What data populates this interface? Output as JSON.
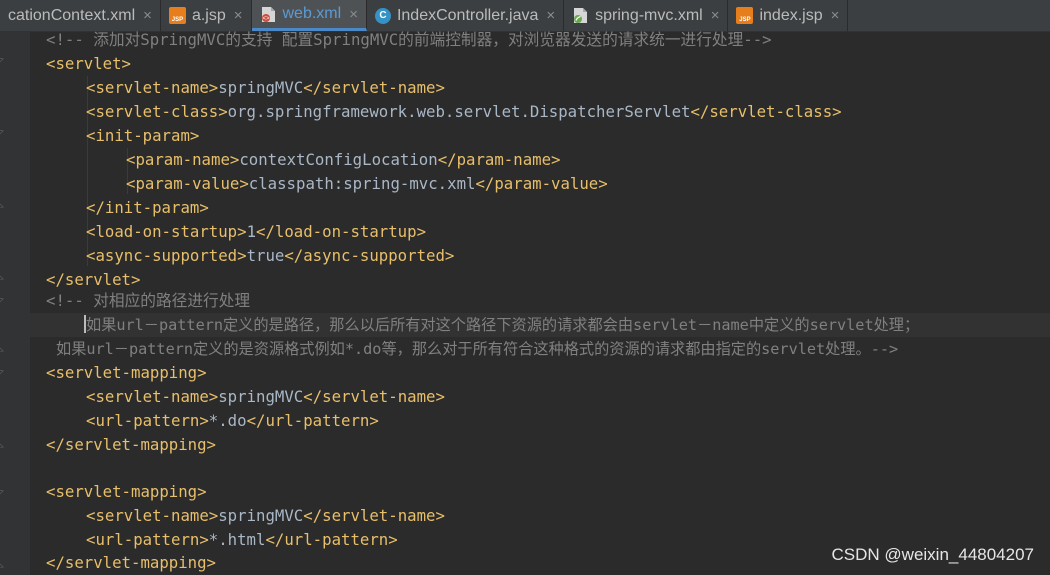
{
  "tabs": [
    {
      "label": "cationContext.xml",
      "icon": "xml-file-icon",
      "active": false
    },
    {
      "label": "a.jsp",
      "icon": "jsp-file-icon",
      "active": false
    },
    {
      "label": "web.xml",
      "icon": "xml-file-icon",
      "active": true
    },
    {
      "label": "IndexController.java",
      "icon": "java-class-icon",
      "active": false
    },
    {
      "label": "spring-mvc.xml",
      "icon": "xml-file-icon",
      "active": false
    },
    {
      "label": "index.jsp",
      "icon": "jsp-file-icon",
      "active": false
    }
  ],
  "tab_close_glyph": "×",
  "jsp_icon_text": "JSP",
  "class_icon_text": "C",
  "code": {
    "l1_comment": "<!-- 添加对SpringMVC的支持 配置SpringMVC的前端控制器，对浏览器发送的请求统一进行处理-->",
    "l2_open": "<servlet>",
    "l3_open": "<servlet-name>",
    "l3_text": "springMVC",
    "l3_close": "</servlet-name>",
    "l4_open": "<servlet-class>",
    "l4_text": "org.springframework.web.servlet.DispatcherServlet",
    "l4_close": "</servlet-class>",
    "l5_open": "<init-param>",
    "l6_open": "<param-name>",
    "l6_text": "contextConfigLocation",
    "l6_close": "</param-name>",
    "l7_open": "<param-value>",
    "l7_text": "classpath:spring-mvc.xml",
    "l7_close": "</param-value>",
    "l8_close": "</init-param>",
    "l9_open": "<load-on-startup>",
    "l9_text": "1",
    "l9_close": "</load-on-startup>",
    "l10_open": "<async-supported>",
    "l10_text": "true",
    "l10_close": "</async-supported>",
    "l11_close": "</servlet>",
    "l12_comment": "<!-- 对相应的路径进行处理",
    "l13_comment": "如果url－pattern定义的是路径，那么以后所有对这个路径下资源的请求都会由servlet－name中定义的servlet处理；",
    "l14_comment": "如果url－pattern定义的是资源格式例如*.do等，那么对于所有符合这种格式的资源的请求都由指定的servlet处理。-->",
    "l15_open": "<servlet-mapping>",
    "l16_open": "<servlet-name>",
    "l16_text": "springMVC",
    "l16_close": "</servlet-name>",
    "l17_open": "<url-pattern>",
    "l17_text": "*.do",
    "l17_close": "</url-pattern>",
    "l18_close": "</servlet-mapping>",
    "l20_open": "<servlet-mapping>",
    "l21_open": "<servlet-name>",
    "l21_text": "springMVC",
    "l21_close": "</servlet-name>",
    "l22_open": "<url-pattern>",
    "l22_text": "*.html",
    "l22_close": "</url-pattern>",
    "l23_close": "</servlet-mapping>"
  },
  "watermark": "CSDN @weixin_44804207",
  "colors": {
    "editor_bg": "#2b2b2b",
    "tag": "#e8bf6a",
    "text": "#a9b7c6",
    "comment": "#808080",
    "active_tab_text": "#5b9bd5",
    "jsp_icon": "#e77e1e",
    "class_icon": "#3592c4"
  }
}
